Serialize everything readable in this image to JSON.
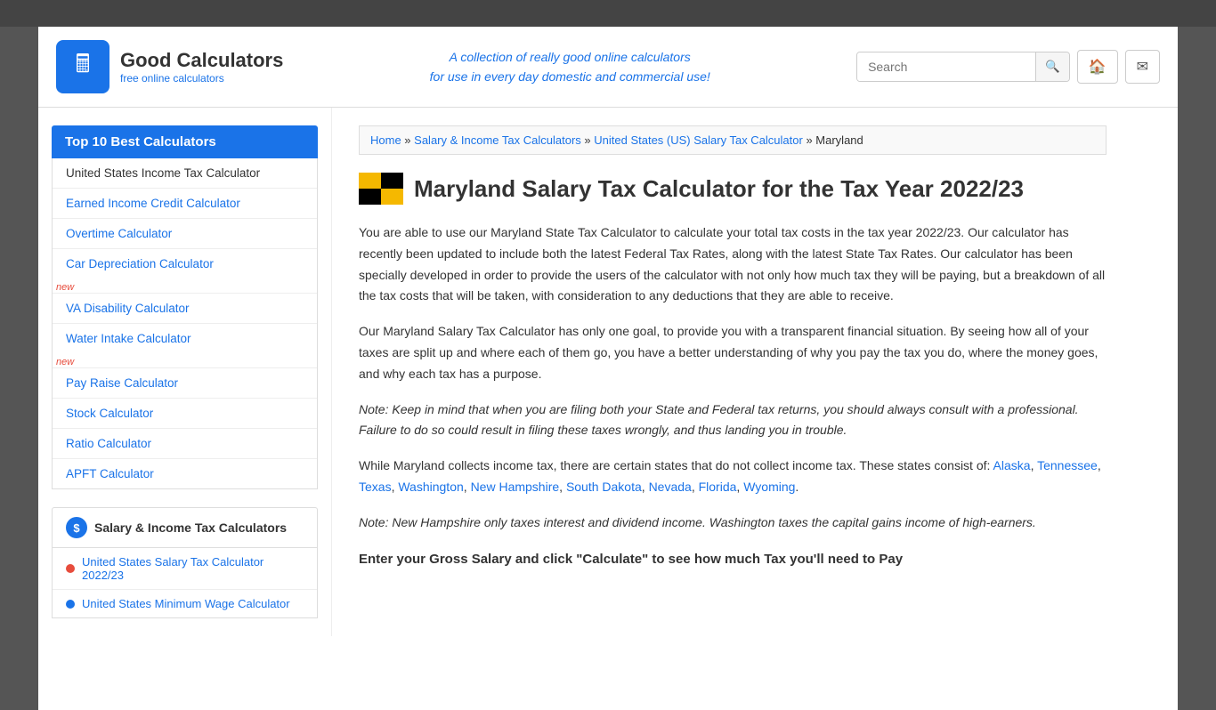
{
  "topbar": {},
  "header": {
    "logo_text": "Good Calculators",
    "logo_sub": "free online calculators",
    "tagline_line1": "A collection of really good online calculators",
    "tagline_line2": "for use in every day domestic and commercial use!",
    "search_placeholder": "Search",
    "home_icon": "🏠",
    "mail_icon": "✉"
  },
  "sidebar": {
    "top10_title": "Top 10 Best Calculators",
    "nav_items": [
      {
        "label": "United States Income Tax Calculator",
        "href": "#",
        "black": true,
        "new": false
      },
      {
        "label": "Earned Income Credit Calculator",
        "href": "#",
        "black": false,
        "new": false
      },
      {
        "label": "Overtime Calculator",
        "href": "#",
        "black": false,
        "new": false
      },
      {
        "label": "Car Depreciation Calculator",
        "href": "#",
        "black": false,
        "new": true
      },
      {
        "label": "VA Disability Calculator",
        "href": "#",
        "black": false,
        "new": false
      },
      {
        "label": "Water Intake Calculator",
        "href": "#",
        "black": false,
        "new": true
      },
      {
        "label": "Pay Raise Calculator",
        "href": "#",
        "black": false,
        "new": false
      },
      {
        "label": "Stock Calculator",
        "href": "#",
        "black": false,
        "new": false
      },
      {
        "label": "Ratio Calculator",
        "href": "#",
        "black": false,
        "new": false
      },
      {
        "label": "APFT Calculator",
        "href": "#",
        "black": false,
        "new": false
      }
    ],
    "salary_section_label": "Salary & Income Tax Calculators",
    "salary_subnav": [
      {
        "label": "United States Salary Tax Calculator 2022/23",
        "href": "#",
        "dot": "red"
      },
      {
        "label": "United States Minimum Wage Calculator",
        "href": "#",
        "dot": "blue"
      }
    ]
  },
  "breadcrumb": {
    "items": [
      {
        "label": "Home",
        "href": "#"
      },
      {
        "label": "Salary & Income Tax Calculators",
        "href": "#"
      },
      {
        "label": "United States (US) Salary Tax Calculator",
        "href": "#"
      },
      {
        "label": "Maryland",
        "href": null
      }
    ]
  },
  "page": {
    "title": "Maryland Salary Tax Calculator for the Tax Year 2022/23",
    "para1": "You are able to use our Maryland State Tax Calculator to calculate your total tax costs in the tax year 2022/23. Our calculator has recently been updated to include both the latest Federal Tax Rates, along with the latest State Tax Rates. Our calculator has been specially developed in order to provide the users of the calculator with not only how much tax they will be paying, but a breakdown of all the tax costs that will be taken, with consideration to any deductions that they are able to receive.",
    "para2": "Our Maryland Salary Tax Calculator has only one goal, to provide you with a transparent financial situation. By seeing how all of your taxes are split up and where each of them go, you have a better understanding of why you pay the tax you do, where the money goes, and why each tax has a purpose.",
    "note1": "Note: Keep in mind that when you are filing both your State and Federal tax returns, you should always consult with a professional. Failure to do so could result in filing these taxes wrongly, and thus landing you in trouble.",
    "para3_prefix": "While Maryland collects income tax, there are certain states that do not collect income tax. These states consist of: ",
    "no_tax_states": [
      {
        "label": "Alaska",
        "href": "#"
      },
      {
        "label": "Tennessee",
        "href": "#"
      },
      {
        "label": "Texas",
        "href": "#"
      },
      {
        "label": "Washington",
        "href": "#"
      },
      {
        "label": "New Hampshire",
        "href": "#"
      },
      {
        "label": "South Dakota",
        "href": "#"
      },
      {
        "label": "Nevada",
        "href": "#"
      },
      {
        "label": "Florida",
        "href": "#"
      },
      {
        "label": "Wyoming",
        "href": "#"
      }
    ],
    "note2": "Note: New Hampshire only taxes interest and dividend income. Washington taxes the capital gains income of high-earners.",
    "cta_heading": "Enter your Gross Salary and click \"Calculate\" to see how much Tax you'll need to Pay"
  }
}
